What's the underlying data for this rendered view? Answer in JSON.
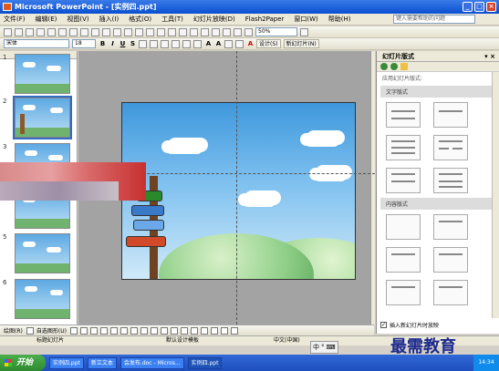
{
  "window": {
    "title": "Microsoft PowerPoint - [实例四.ppt]"
  },
  "menu": [
    "文件(F)",
    "编辑(E)",
    "视图(V)",
    "插入(I)",
    "格式(O)",
    "工具(T)",
    "幻灯片放映(D)",
    "Flash2Paper",
    "窗口(W)",
    "帮助(H)"
  ],
  "help_box": "键入需要帮助的问题",
  "toolbar": {
    "zoom": "50%"
  },
  "format_bar": {
    "font": "宋体",
    "size": "18",
    "design_button": "设计(S)",
    "new_slide_button": "新幻灯片(N)"
  },
  "thumbnails": [
    {
      "num": "1"
    },
    {
      "num": "2"
    },
    {
      "num": "3"
    },
    {
      "num": "4"
    },
    {
      "num": "5"
    },
    {
      "num": "6"
    }
  ],
  "task_pane": {
    "title": "幻灯片版式",
    "apply_label": "应用幻灯片版式:",
    "section_text": "文字版式",
    "section_content": "内容版式",
    "footer_checkbox": "插入新幻灯片时放映"
  },
  "draw_bar": {
    "draw_label": "绘图(R)",
    "autoshapes_label": "自选图形(U)"
  },
  "status_bar": {
    "left": "标题幻灯片",
    "middle": "默认设计模板",
    "right": "中文(中国)"
  },
  "ime": {
    "mode": "中"
  },
  "taskbar": {
    "start": "开始",
    "items": [
      "实例四.ppt",
      "新立文本",
      "会发布.doc - Micros...",
      "实例四.ppt"
    ],
    "clock": "14:34"
  },
  "watermark": "最需教育"
}
